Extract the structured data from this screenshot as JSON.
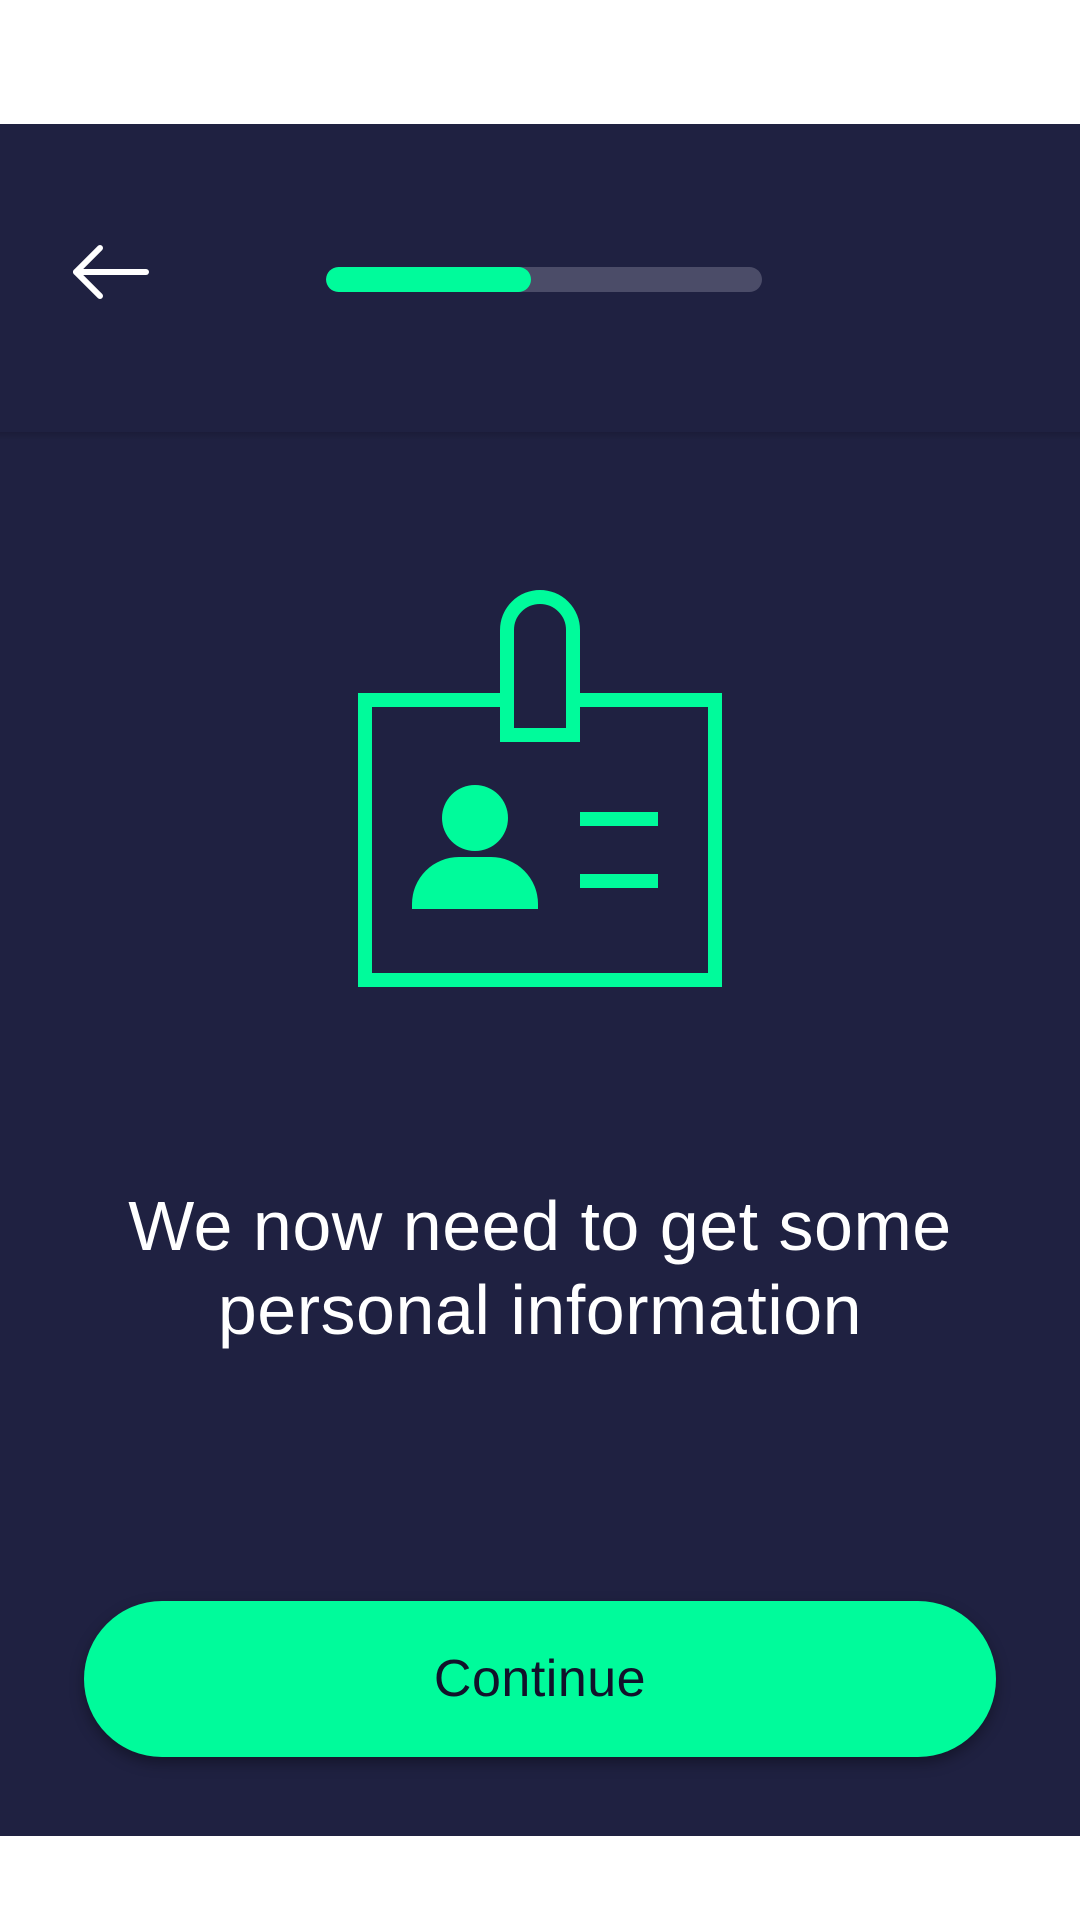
{
  "header": {
    "back_icon": "arrow-left-icon",
    "progress_fraction": 0.47
  },
  "illustration": {
    "icon": "id-badge-icon"
  },
  "main": {
    "headline": "We now need to get some personal information"
  },
  "footer": {
    "continue_label": "Continue"
  },
  "colors": {
    "background": "#1f2141",
    "accent": "#00fb9b",
    "progress_track": "#4b4c68",
    "text": "#ffffff"
  }
}
